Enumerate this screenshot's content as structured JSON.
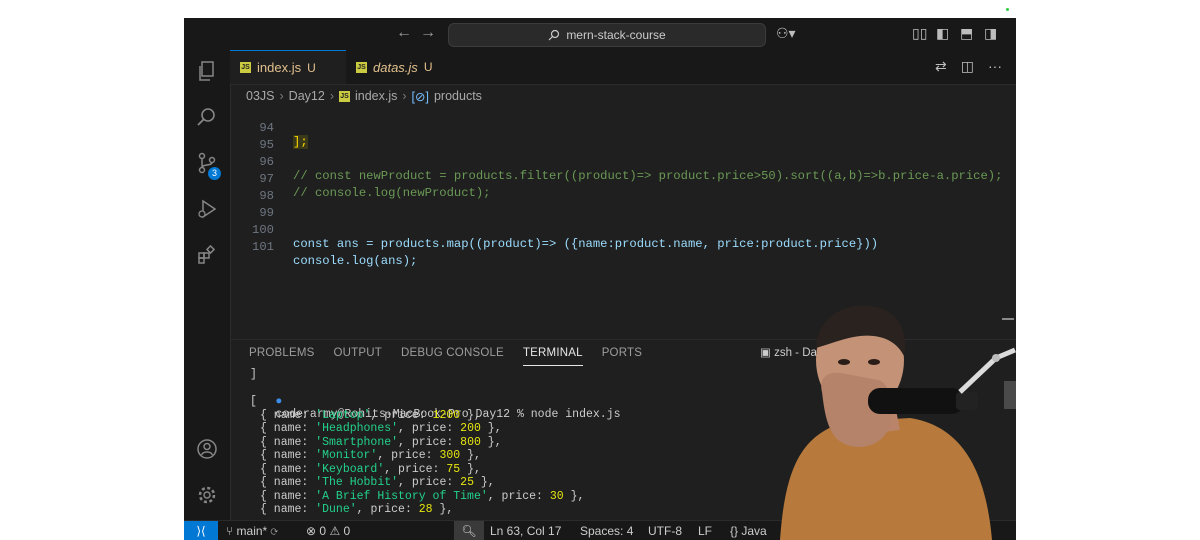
{
  "titlebar": {
    "search_text": "mern-stack-course",
    "back_icon": "arrow-left-icon",
    "forward_icon": "arrow-right-icon",
    "copilot_icon": "copilot-icon"
  },
  "tabs": [
    {
      "label": "index.js",
      "status": "U"
    },
    {
      "label": "datas.js",
      "status": "U"
    }
  ],
  "breadcrumb": [
    "03JS",
    "Day12",
    "index.js",
    "products"
  ],
  "code_lines": [
    {
      "num": "94",
      "text": "];"
    },
    {
      "num": "95",
      "text": ""
    },
    {
      "num": "96",
      "text": "// const newProduct = products.filter((product)=> product.price>50).sort((a,b)=>b.price-a.price);"
    },
    {
      "num": "97",
      "text": "// console.log(newProduct);"
    },
    {
      "num": "98",
      "text": ""
    },
    {
      "num": "99",
      "text": ""
    },
    {
      "num": "100",
      "text": "const ans = products.map((product)=> ({name:product.name, price:product.price}))"
    },
    {
      "num": "101",
      "text": "console.log(ans);"
    }
  ],
  "panel": {
    "tabs": [
      "PROBLEMS",
      "OUTPUT",
      "DEBUG CONSOLE",
      "TERMINAL",
      "PORTS"
    ],
    "active_tab": "TERMINAL",
    "shell_label": "zsh - Da"
  },
  "terminal": {
    "bracket_close": "]",
    "prompt": "coderarmy@Rohits-MacBook-Pro Day12 % node index.js",
    "bracket_open": "[",
    "rows": [
      {
        "name": "'Laptop'",
        "price": "1200"
      },
      {
        "name": "'Headphones'",
        "price": "200"
      },
      {
        "name": "'Smartphone'",
        "price": "800"
      },
      {
        "name": "'Monitor'",
        "price": "300"
      },
      {
        "name": "'Keyboard'",
        "price": "75"
      },
      {
        "name": "'The Hobbit'",
        "price": "25"
      },
      {
        "name": "'A Brief History of Time'",
        "price": "30"
      },
      {
        "name": "'Dune'",
        "price": "28"
      }
    ]
  },
  "statusbar": {
    "branch": "main*",
    "errors": "0",
    "warnings": "0",
    "cursor": "Ln 63, Col 17",
    "spaces": "Spaces: 4",
    "encoding": "UTF-8",
    "eol": "LF",
    "language": "Java"
  },
  "activity_badge": "3",
  "colors": {
    "accent": "#0078d4",
    "editor_bg": "#1f1f1f",
    "modified": "#e2c08d"
  }
}
